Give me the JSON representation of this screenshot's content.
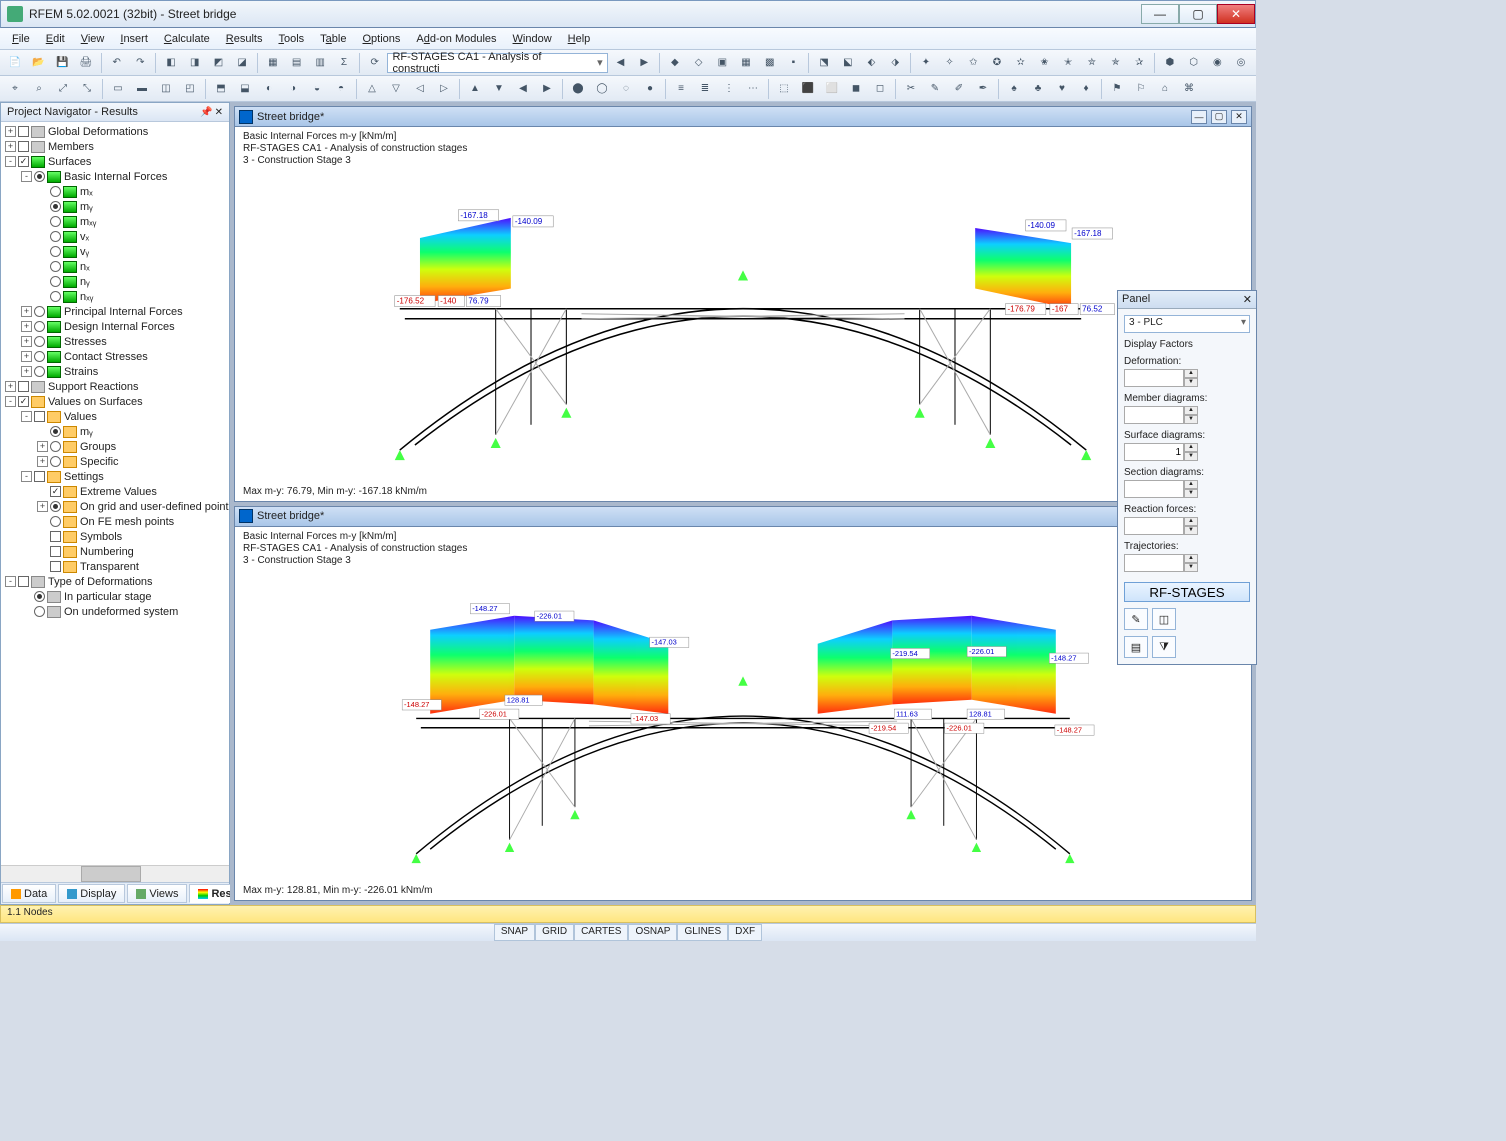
{
  "title": "RFEM 5.02.0021 (32bit) - Street bridge",
  "menu": [
    "File",
    "Edit",
    "View",
    "Insert",
    "Calculate",
    "Results",
    "Tools",
    "Table",
    "Options",
    "Add-on Modules",
    "Window",
    "Help"
  ],
  "combo_results": "RF-STAGES CA1 - Analysis of constructi",
  "navigator": {
    "header": "Project Navigator - Results",
    "tabs": [
      "Data",
      "Display",
      "Views",
      "Results"
    ],
    "active_tab": 3
  },
  "tree": [
    {
      "d": 0,
      "exp": "+",
      "chk": "",
      "txt": "Global Deformations",
      "ico": "gry"
    },
    {
      "d": 0,
      "exp": "+",
      "chk": "",
      "txt": "Members",
      "ico": "gry"
    },
    {
      "d": 0,
      "exp": "-",
      "chk": "✓",
      "txt": "Surfaces",
      "ico": "grn"
    },
    {
      "d": 1,
      "exp": "-",
      "rad": "on",
      "txt": "Basic Internal Forces",
      "ico": "grn"
    },
    {
      "d": 2,
      "exp": "",
      "rad": "",
      "txt": "mₓ",
      "ico": "grn"
    },
    {
      "d": 2,
      "exp": "",
      "rad": "on",
      "txt": "mᵧ",
      "ico": "grn"
    },
    {
      "d": 2,
      "exp": "",
      "rad": "",
      "txt": "mₓᵧ",
      "ico": "grn"
    },
    {
      "d": 2,
      "exp": "",
      "rad": "",
      "txt": "vₓ",
      "ico": "grn"
    },
    {
      "d": 2,
      "exp": "",
      "rad": "",
      "txt": "vᵧ",
      "ico": "grn"
    },
    {
      "d": 2,
      "exp": "",
      "rad": "",
      "txt": "nₓ",
      "ico": "grn"
    },
    {
      "d": 2,
      "exp": "",
      "rad": "",
      "txt": "nᵧ",
      "ico": "grn"
    },
    {
      "d": 2,
      "exp": "",
      "rad": "",
      "txt": "nₓᵧ",
      "ico": "grn"
    },
    {
      "d": 1,
      "exp": "+",
      "rad": "",
      "txt": "Principal Internal Forces",
      "ico": "grn"
    },
    {
      "d": 1,
      "exp": "+",
      "rad": "",
      "txt": "Design Internal Forces",
      "ico": "grn"
    },
    {
      "d": 1,
      "exp": "+",
      "rad": "",
      "txt": "Stresses",
      "ico": "grn"
    },
    {
      "d": 1,
      "exp": "+",
      "rad": "",
      "txt": "Contact Stresses",
      "ico": "grn"
    },
    {
      "d": 1,
      "exp": "+",
      "rad": "",
      "txt": "Strains",
      "ico": "grn"
    },
    {
      "d": 0,
      "exp": "+",
      "chk": "",
      "txt": "Support Reactions",
      "ico": "gry"
    },
    {
      "d": 0,
      "exp": "-",
      "chk": "✓",
      "txt": "Values on Surfaces",
      "ico": ""
    },
    {
      "d": 1,
      "exp": "-",
      "chk": "",
      "txt": "Values",
      "ico": ""
    },
    {
      "d": 2,
      "exp": "",
      "rad": "on",
      "txt": "mᵧ",
      "ico": ""
    },
    {
      "d": 2,
      "exp": "+",
      "rad": "",
      "txt": "Groups",
      "ico": ""
    },
    {
      "d": 2,
      "exp": "+",
      "rad": "",
      "txt": "Specific",
      "ico": ""
    },
    {
      "d": 1,
      "exp": "-",
      "chk": "",
      "txt": "Settings",
      "ico": ""
    },
    {
      "d": 2,
      "exp": "",
      "chk": "✓",
      "txt": "Extreme Values",
      "ico": ""
    },
    {
      "d": 2,
      "exp": "+",
      "rad": "on",
      "txt": "On grid and user-defined point",
      "ico": ""
    },
    {
      "d": 2,
      "exp": "",
      "rad": "",
      "txt": "On FE mesh points",
      "ico": ""
    },
    {
      "d": 2,
      "exp": "",
      "chk": "",
      "txt": "Symbols",
      "ico": ""
    },
    {
      "d": 2,
      "exp": "",
      "chk": "",
      "txt": "Numbering",
      "ico": ""
    },
    {
      "d": 2,
      "exp": "",
      "chk": "",
      "txt": "Transparent",
      "ico": ""
    },
    {
      "d": 0,
      "exp": "-",
      "chk": "",
      "txt": "Type of Deformations",
      "ico": "gry"
    },
    {
      "d": 1,
      "exp": "",
      "rad": "on",
      "txt": "In particular stage",
      "ico": "gry"
    },
    {
      "d": 1,
      "exp": "",
      "rad": "",
      "txt": "On undeformed system",
      "ico": "gry"
    }
  ],
  "doc_title": "Street bridge*",
  "doc_info": {
    "l1": "Basic Internal Forces m-y [kNm/m]",
    "l2": "RF-STAGES CA1 - Analysis of construction stages",
    "l3": "3 - Construction Stage 3"
  },
  "doc1_summary": "Max m-y: 76.79, Min m-y: -167.18 kNm/m",
  "doc2_summary": "Max m-y: 128.81, Min m-y: -226.01 kNm/m",
  "doc1_values": {
    "left": [
      "-167.18",
      "-140.09",
      "-176.52",
      "-140",
      "76.79"
    ],
    "right": [
      "-140.09",
      "-167.18",
      "-176.79",
      "-167",
      "76.52"
    ]
  },
  "doc2_values": {
    "left": [
      "-148.27",
      "-226.01",
      "-148.27",
      "128.81",
      "-226.01",
      "-147.03",
      "-147.03"
    ],
    "right": [
      "-219.54",
      "-226.01",
      "-148.27",
      "111.63",
      "-219.54",
      "128.81",
      "-226.01",
      "-148.27"
    ]
  },
  "panel": {
    "title": "Panel",
    "combo": "3 - PLC",
    "section": "Display Factors",
    "labels": [
      "Deformation:",
      "Member diagrams:",
      "Surface diagrams:",
      "Section diagrams:",
      "Reaction forces:",
      "Trajectories:"
    ],
    "surface_val": "1",
    "button": "RF-STAGES"
  },
  "status1": "1.1 Nodes",
  "status2": [
    "SNAP",
    "GRID",
    "CARTES",
    "OSNAP",
    "GLINES",
    "DXF"
  ]
}
